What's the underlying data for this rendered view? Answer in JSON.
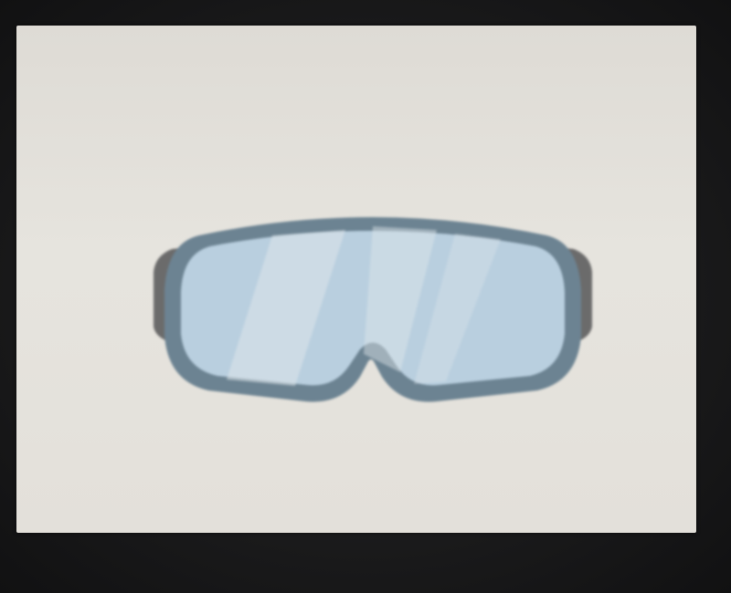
{
  "scene": {
    "subject": "safety-goggles",
    "colors": {
      "bezel": "#1b1b1c",
      "screen": "#e3e0da",
      "frame": "#6c8392",
      "strap": "#6b6b6b",
      "lens": "#b9cfdf",
      "lens_highlight": "#dfe6ea"
    }
  }
}
